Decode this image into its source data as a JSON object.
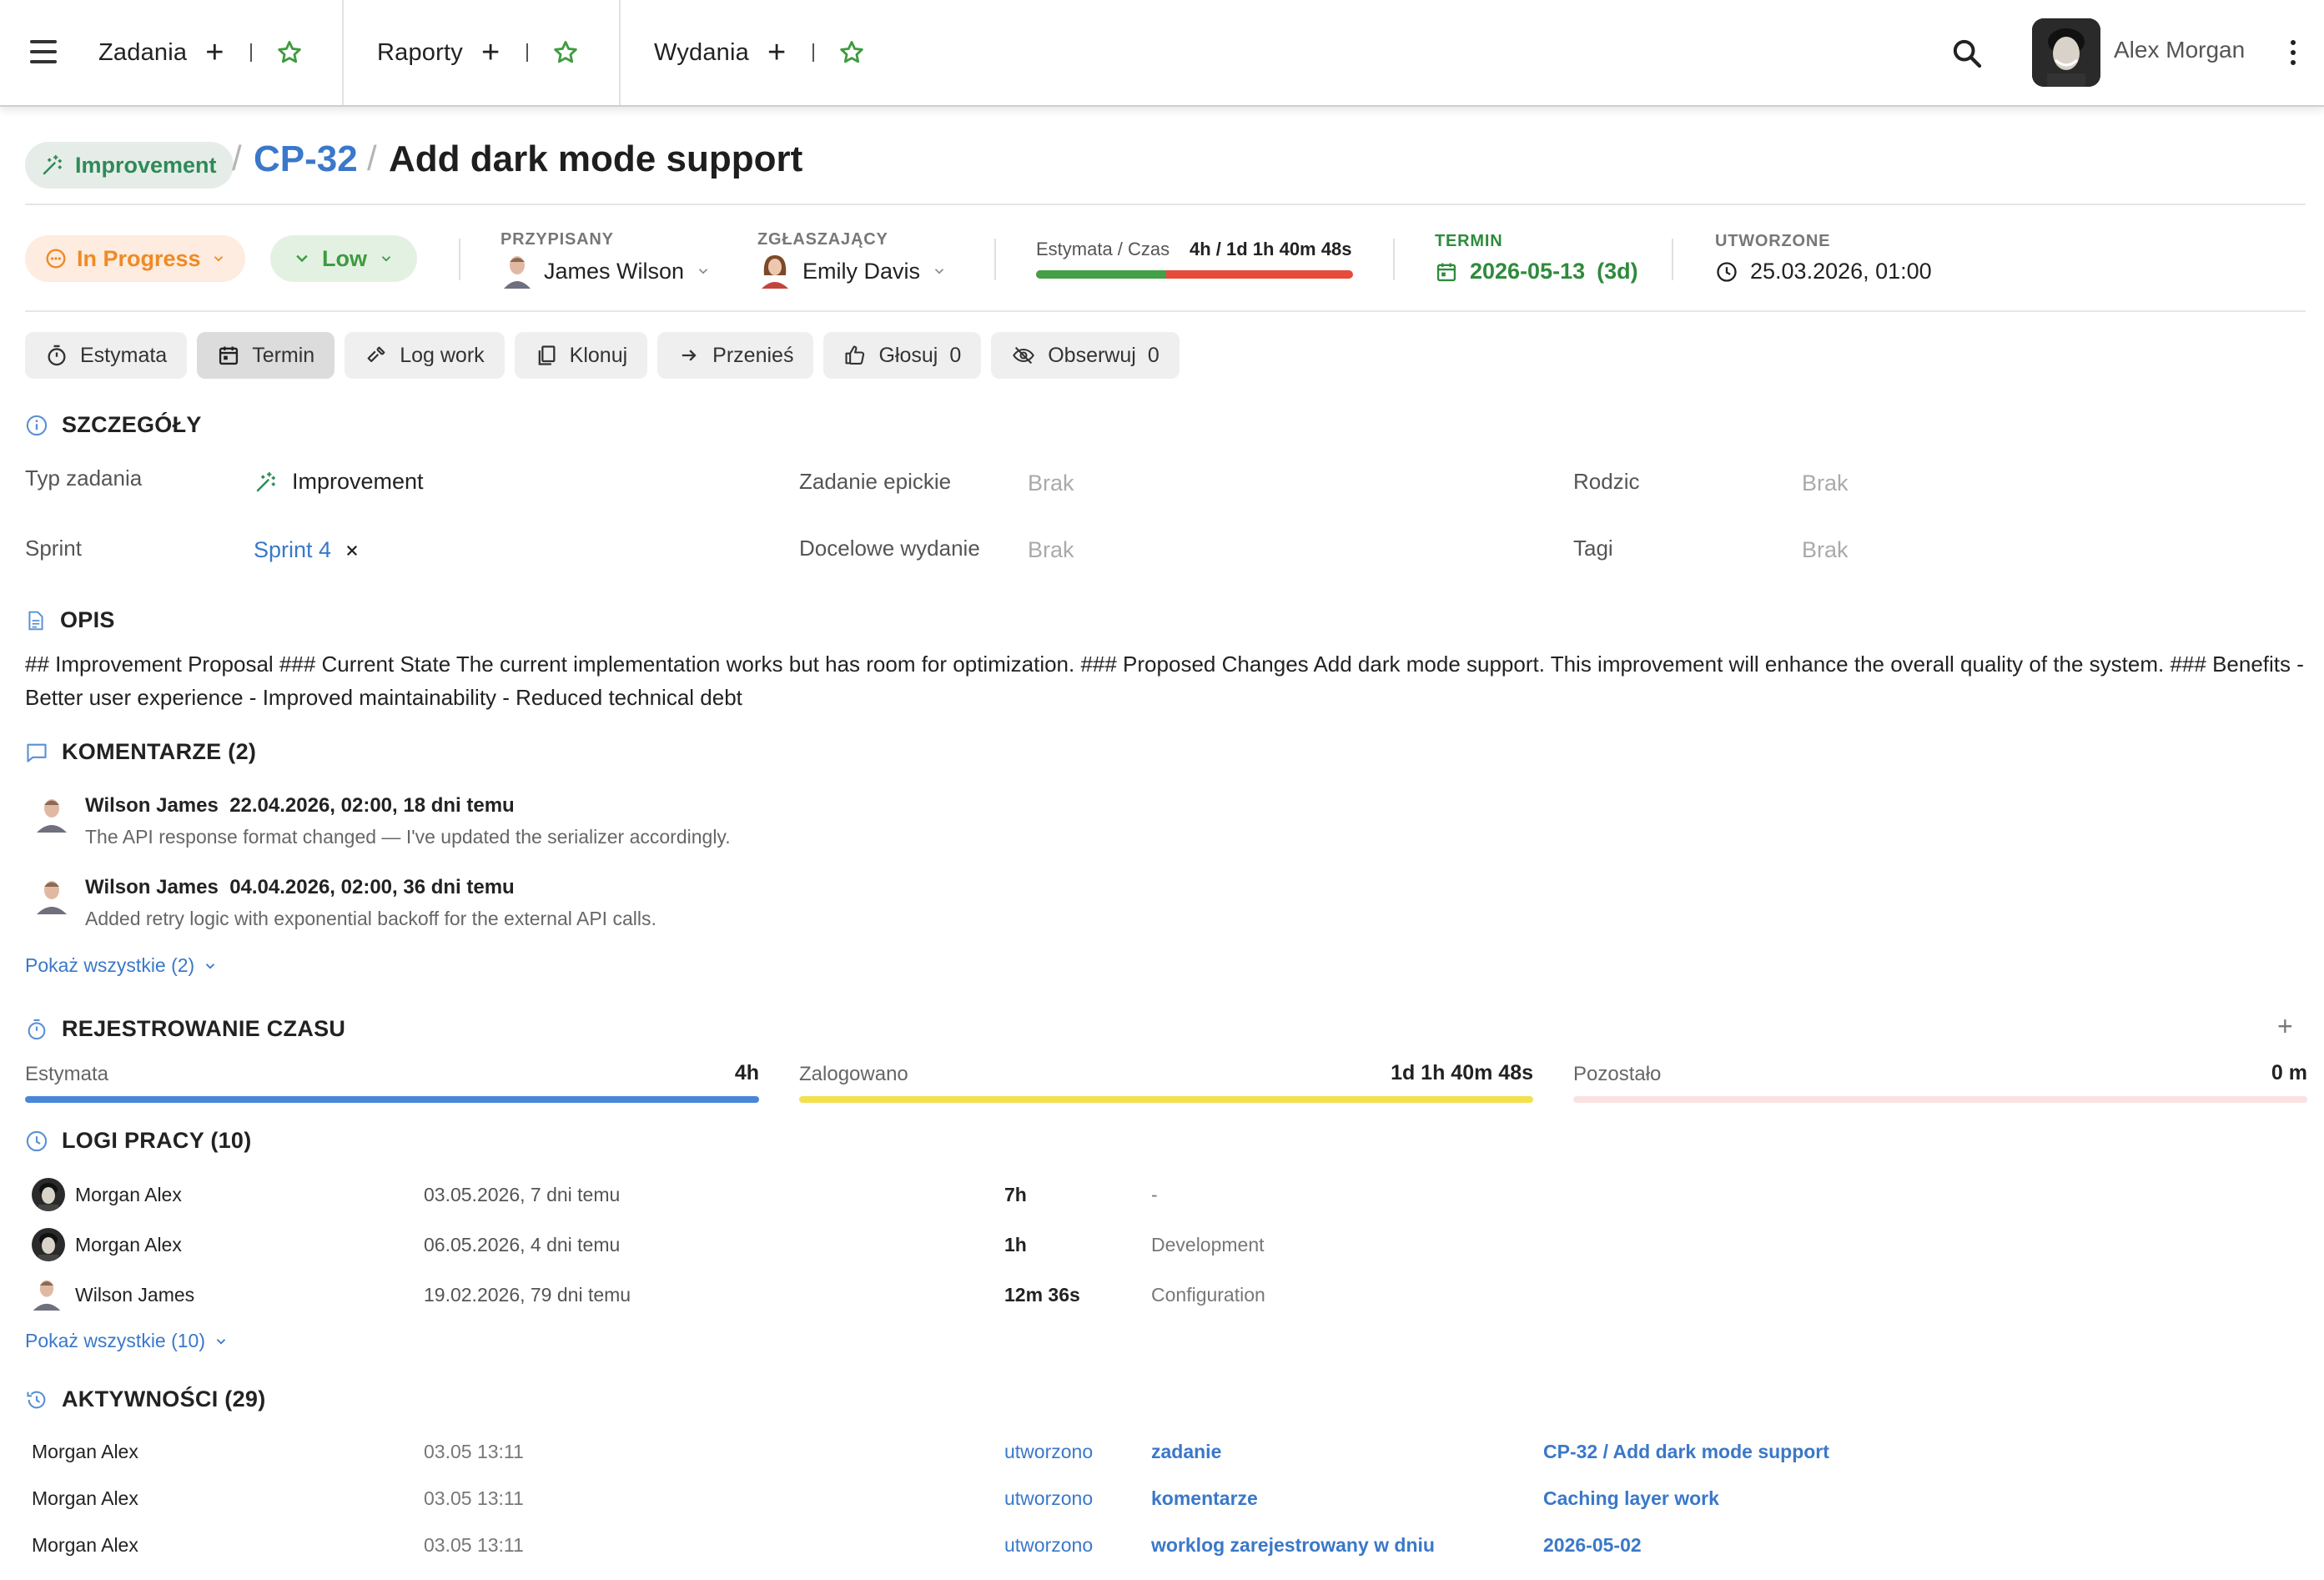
{
  "topbar": {
    "tabs": [
      {
        "label": "Zadania"
      },
      {
        "label": "Raporty"
      },
      {
        "label": "Wydania"
      }
    ],
    "user_name": "Alex Morgan",
    "accent_green": "#3f9b3f"
  },
  "issue": {
    "type": "Improvement",
    "key": "CP-32",
    "title": "Add dark mode support",
    "status": "In Progress",
    "priority": "Low",
    "assignee_label": "PRZYPISANY",
    "assignee": "James Wilson",
    "reporter_label": "ZGŁASZAJĄCY",
    "reporter": "Emily Davis",
    "estimate_label": "Estymata / Czas",
    "estimate_value": "4h / 1d 1h 40m 48s",
    "estimate_progress": 0.41,
    "due_label": "TERMIN",
    "due_date": "2026-05-13",
    "due_rel": "(3d)",
    "created_label": "UTWORZONE",
    "created": "25.03.2026, 01:00"
  },
  "actions": [
    {
      "label": "Estymata",
      "icon": "timer-icon"
    },
    {
      "label": "Termin",
      "icon": "calendar-icon"
    },
    {
      "label": "Log work",
      "icon": "hammer-icon"
    },
    {
      "label": "Klonuj",
      "icon": "copy-icon"
    },
    {
      "label": "Przenieś",
      "icon": "arrow-right-icon"
    },
    {
      "label": "Głosuj",
      "icon": "thumbs-up-icon",
      "count": "0"
    },
    {
      "label": "Obserwuj",
      "icon": "eye-off-icon",
      "count": "0"
    }
  ],
  "details": {
    "title": "SZCZEGÓŁY",
    "type_label": "Typ zadania",
    "type_value": "Improvement",
    "sprint_label": "Sprint",
    "sprint_value": "Sprint 4",
    "epic_label": "Zadanie epickie",
    "epic_value": "Brak",
    "release_label": "Docelowe wydanie",
    "release_value": "Brak",
    "parent_label": "Rodzic",
    "parent_value": "Brak",
    "tags_label": "Tagi",
    "tags_value": "Brak"
  },
  "description": {
    "title": "OPIS",
    "text": "## Improvement Proposal ### Current State The current implementation works but has room for optimization. ### Proposed Changes Add dark mode support. This improvement will enhance the overall quality of the system. ### Benefits - Better user experience - Improved maintainability - Reduced technical debt"
  },
  "comments": {
    "title": "KOMENTARZE (2)",
    "items": [
      {
        "author": "Wilson James",
        "when": "22.04.2026, 02:00, 18 dni temu",
        "text": "The API response format changed — I've updated the serializer accordingly."
      },
      {
        "author": "Wilson James",
        "when": "04.04.2026, 02:00, 36 dni temu",
        "text": "Added retry logic with exponential backoff for the external API calls."
      }
    ],
    "show_all": "Pokaż wszystkie (2)"
  },
  "time_tracking": {
    "title": "REJESTROWANIE CZASU",
    "estimate_label": "Estymata",
    "estimate_value": "4h",
    "logged_label": "Zalogowano",
    "logged_value": "1d 1h 40m 48s",
    "remaining_label": "Pozostało",
    "remaining_value": "0 m",
    "colors": {
      "estimate": "#4a86d8",
      "logged": "#f4e04d",
      "remaining": "#fbe2e2"
    }
  },
  "worklogs": {
    "title": "LOGI PRACY (10)",
    "items": [
      {
        "user": "Morgan Alex",
        "date": "03.05.2026, 7 dni temu",
        "time": "7h",
        "note": "-"
      },
      {
        "user": "Morgan Alex",
        "date": "06.05.2026, 4 dni temu",
        "time": "1h",
        "note": "Development"
      },
      {
        "user": "Wilson James",
        "date": "19.02.2026, 79 dni temu",
        "time": "12m 36s",
        "note": "Configuration"
      }
    ],
    "show_all": "Pokaż wszystkie (10)"
  },
  "activities": {
    "title": "AKTYWNOŚCI (29)",
    "items": [
      {
        "user": "Morgan Alex",
        "when": "03.05 13:11",
        "action": "utworzono",
        "object": "zadanie",
        "target": "CP-32 / Add dark mode support"
      },
      {
        "user": "Morgan Alex",
        "when": "03.05 13:11",
        "action": "utworzono",
        "object": "komentarze",
        "target": "Caching layer work"
      },
      {
        "user": "Morgan Alex",
        "when": "03.05 13:11",
        "action": "utworzono",
        "object": "worklog zarejestrowany w dniu",
        "target": "2026-05-02"
      }
    ]
  }
}
